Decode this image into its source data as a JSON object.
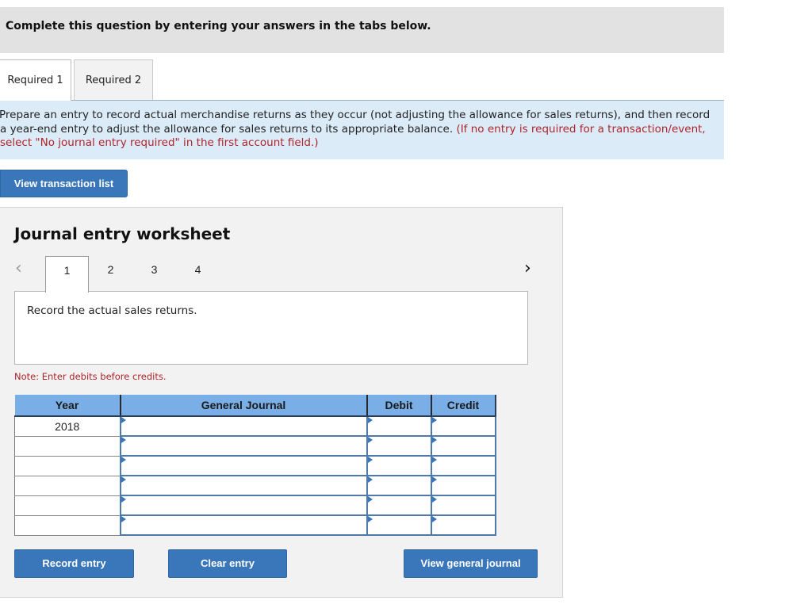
{
  "header": {
    "title": "Complete this question by entering your answers in the tabs below."
  },
  "tabs": [
    {
      "label": "Required 1",
      "active": true
    },
    {
      "label": "Required 2",
      "active": false
    }
  ],
  "instructions": {
    "text": "Prepare an entry to record actual merchandise returns as they occur (not adjusting the allowance for sales returns), and then record a year-end entry to adjust the allowance for sales returns to its appropriate balance.",
    "note": "(If no entry is required for a transaction/event, select \"No journal entry required\" in the first account field.)"
  },
  "view_transaction_list_label": "View transaction list",
  "worksheet": {
    "title": "Journal entry worksheet",
    "prev_icon": "chevron-left-icon",
    "next_icon": "chevron-right-icon",
    "prev_glyph": "‹",
    "next_glyph": "›",
    "steps": [
      "1",
      "2",
      "3",
      "4"
    ],
    "active_step": "1",
    "description": "Record the actual sales returns.",
    "note": "Note: Enter debits before credits.",
    "table": {
      "headers": [
        "Year",
        "General Journal",
        "Debit",
        "Credit"
      ],
      "rows": [
        {
          "year": "2018",
          "account": "",
          "debit": "",
          "credit": ""
        },
        {
          "year": "",
          "account": "",
          "debit": "",
          "credit": ""
        },
        {
          "year": "",
          "account": "",
          "debit": "",
          "credit": ""
        },
        {
          "year": "",
          "account": "",
          "debit": "",
          "credit": ""
        },
        {
          "year": "",
          "account": "",
          "debit": "",
          "credit": ""
        },
        {
          "year": "",
          "account": "",
          "debit": "",
          "credit": ""
        }
      ]
    },
    "buttons": {
      "record": "Record entry",
      "clear": "Clear entry",
      "view_gj": "View general journal"
    }
  },
  "colors": {
    "button_blue": "#3a76ba",
    "header_blue": "#7aaee6",
    "instruction_bg": "#dcebf8",
    "note_red": "#b0242b"
  }
}
